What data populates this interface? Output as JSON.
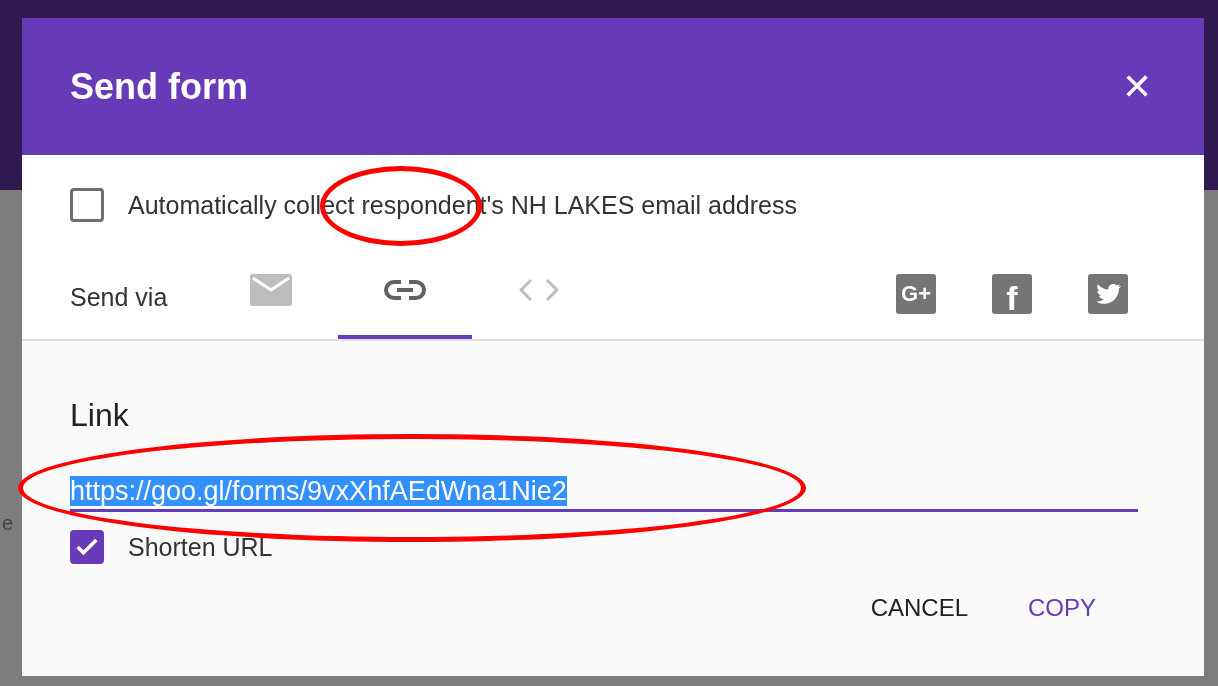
{
  "background_page": {
    "text": "e"
  },
  "dialog": {
    "title": "Send form",
    "close": "✕",
    "collect_email": {
      "label": "Automatically collect respondent's NH LAKES email address",
      "checked": false
    },
    "send_via": {
      "label": "Send via",
      "tabs": [
        {
          "kind": "email",
          "selected": false
        },
        {
          "kind": "link",
          "selected": true
        },
        {
          "kind": "embed",
          "selected": false
        }
      ],
      "share": [
        {
          "kind": "google",
          "label": "G+"
        },
        {
          "kind": "facebook",
          "label": "f"
        },
        {
          "kind": "twitter"
        }
      ]
    },
    "link": {
      "heading": "Link",
      "value": "https://goo.gl/forms/9vxXhfAEdWna1Nie2",
      "selected_text": true
    },
    "shorten_url": {
      "label": "Shorten URL",
      "checked": true
    },
    "buttons": [
      {
        "label": "CANCEL",
        "primary": false
      },
      {
        "label": "COPY",
        "primary": true
      }
    ]
  },
  "annotations": [
    {
      "kind": "ellipse",
      "color": "#ff0000"
    },
    {
      "kind": "ellipse",
      "color": "#ff0000"
    }
  ]
}
